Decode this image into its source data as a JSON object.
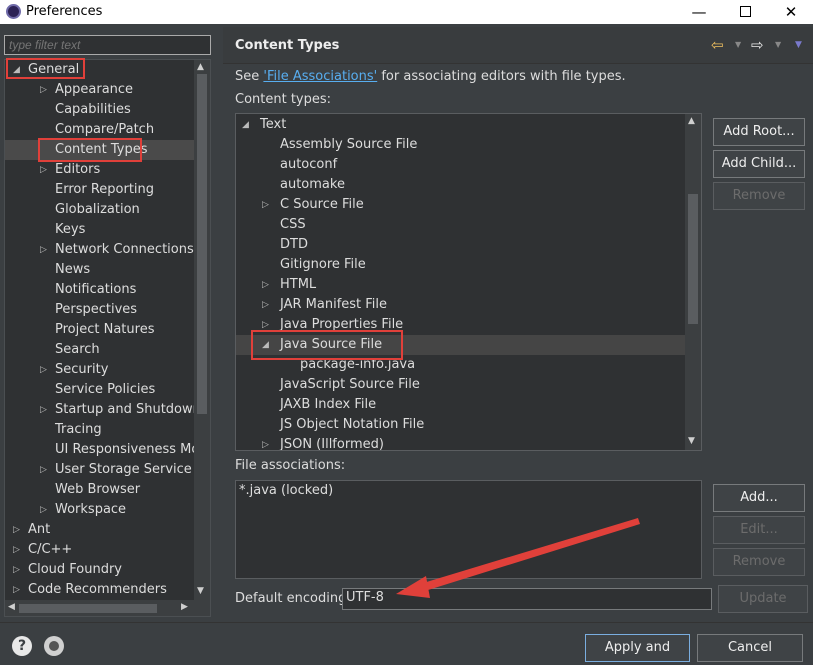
{
  "window": {
    "title": "Preferences",
    "minimize": "—",
    "close": "✕"
  },
  "filter": {
    "placeholder": "type filter text"
  },
  "tree": {
    "items": [
      {
        "label": "General",
        "arrow": "◢"
      },
      {
        "label": "Appearance",
        "arrow": "▷"
      },
      {
        "label": "Capabilities"
      },
      {
        "label": "Compare/Patch"
      },
      {
        "label": "Content Types"
      },
      {
        "label": "Editors",
        "arrow": "▷"
      },
      {
        "label": "Error Reporting"
      },
      {
        "label": "Globalization"
      },
      {
        "label": "Keys"
      },
      {
        "label": "Network Connections",
        "arrow": "▷"
      },
      {
        "label": "News"
      },
      {
        "label": "Notifications"
      },
      {
        "label": "Perspectives"
      },
      {
        "label": "Project Natures"
      },
      {
        "label": "Search"
      },
      {
        "label": "Security",
        "arrow": "▷"
      },
      {
        "label": "Service Policies"
      },
      {
        "label": "Startup and Shutdown",
        "arrow": "▷"
      },
      {
        "label": "Tracing"
      },
      {
        "label": "UI Responsiveness Monit"
      },
      {
        "label": "User Storage Service",
        "arrow": "▷"
      },
      {
        "label": "Web Browser"
      },
      {
        "label": "Workspace",
        "arrow": "▷"
      },
      {
        "label": "Ant",
        "arrow": "▷"
      },
      {
        "label": "C/C++",
        "arrow": "▷"
      },
      {
        "label": "Cloud Foundry",
        "arrow": "▷"
      },
      {
        "label": "Code Recommenders",
        "arrow": "▷"
      }
    ]
  },
  "header": {
    "title": "Content Types"
  },
  "main": {
    "see_prefix": "See ",
    "see_link": "'File Associations'",
    "see_suffix": " for associating editors with file types.",
    "content_types_label": "Content types:",
    "content_types": [
      {
        "label": "Text",
        "arrow": "◢"
      },
      {
        "label": "Assembly Source File"
      },
      {
        "label": "autoconf"
      },
      {
        "label": "automake"
      },
      {
        "label": "C Source File",
        "arrow": "▷"
      },
      {
        "label": "CSS"
      },
      {
        "label": "DTD"
      },
      {
        "label": "Gitignore File"
      },
      {
        "label": "HTML",
        "arrow": "▷"
      },
      {
        "label": "JAR Manifest File",
        "arrow": "▷"
      },
      {
        "label": "Java Properties File",
        "arrow": "▷"
      },
      {
        "label": "Java Source File",
        "arrow": "◢"
      },
      {
        "label": "package-info.java"
      },
      {
        "label": "JavaScript Source File"
      },
      {
        "label": "JAXB Index File"
      },
      {
        "label": "JS Object Notation File"
      },
      {
        "label": "JSON (Illformed)",
        "arrow": "▷"
      }
    ],
    "add_root": "Add Root...",
    "add_child": "Add Child...",
    "remove": "Remove",
    "file_assoc_label": "File associations:",
    "file_assoc": [
      "*.java (locked)"
    ],
    "add": "Add...",
    "edit": "Edit...",
    "remove2": "Remove",
    "encoding_label": "Default encoding:",
    "encoding_value": "UTF-8",
    "update": "Update"
  },
  "footer": {
    "help": "?",
    "apply_close": "Apply and Close",
    "cancel": "Cancel"
  }
}
